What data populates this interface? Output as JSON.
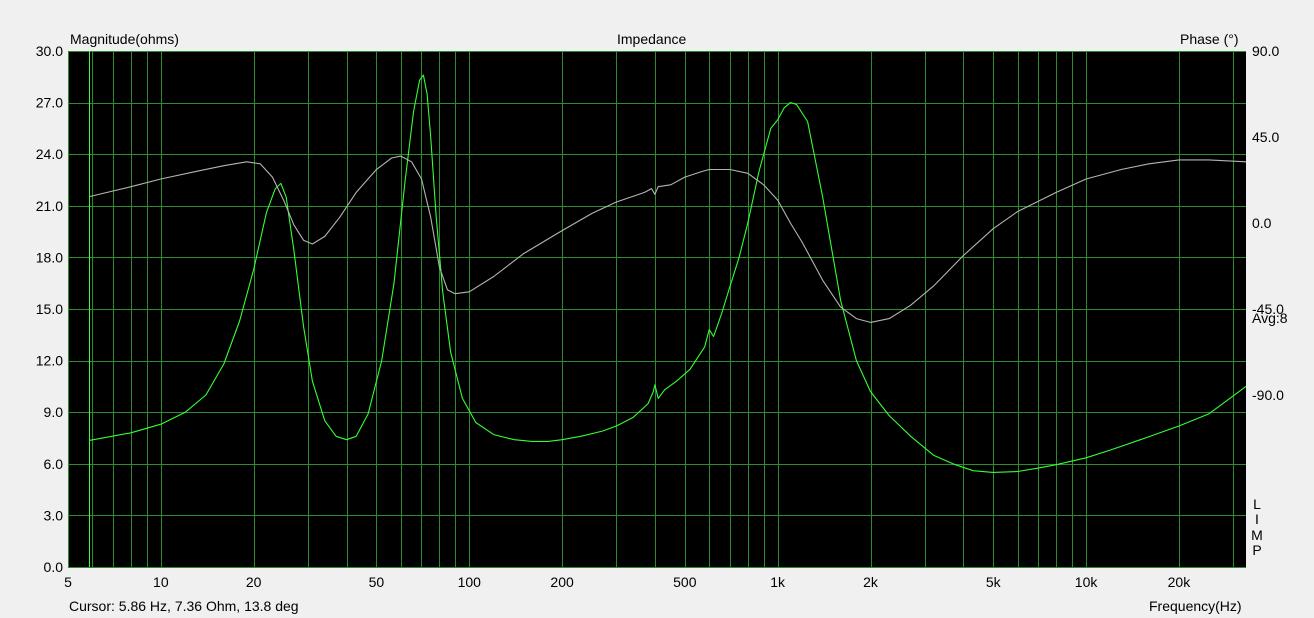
{
  "window": {
    "cursor_readout": "Cursor: 5.86 Hz, 7.36 Ohm, 13.8 deg",
    "avg_label": "Avg:8",
    "side_letters": [
      "L",
      "I",
      "M",
      "P"
    ]
  },
  "chart_data": {
    "type": "line",
    "title": "Impedance",
    "ylabel": "Magnitude(ohms)",
    "y2label": "Phase (°)",
    "xlabel": "Frequency(Hz)",
    "x_scale": "log",
    "xlim": [
      5,
      33000
    ],
    "ylim": [
      0,
      30
    ],
    "y2lim": [
      -180,
      90
    ],
    "x_ticks": [
      {
        "value": 5,
        "label": "5"
      },
      {
        "value": 10,
        "label": "10"
      },
      {
        "value": 20,
        "label": "20"
      },
      {
        "value": 50,
        "label": "50"
      },
      {
        "value": 100,
        "label": "100"
      },
      {
        "value": 200,
        "label": "200"
      },
      {
        "value": 500,
        "label": "500"
      },
      {
        "value": 1000,
        "label": "1k"
      },
      {
        "value": 2000,
        "label": "2k"
      },
      {
        "value": 5000,
        "label": "5k"
      },
      {
        "value": 10000,
        "label": "10k"
      },
      {
        "value": 20000,
        "label": "20k"
      }
    ],
    "y_ticks": [
      "0.0",
      "3.0",
      "6.0",
      "9.0",
      "12.0",
      "15.0",
      "18.0",
      "21.0",
      "24.0",
      "27.0",
      "30.0"
    ],
    "y2_ticks": [
      {
        "value": 90,
        "label": "90.0"
      },
      {
        "value": 45,
        "label": "45.0"
      },
      {
        "value": 0,
        "label": "0.0"
      },
      {
        "value": -45,
        "label": "-45.0"
      },
      {
        "value": -90,
        "label": "-90.0"
      }
    ],
    "grid": true,
    "colors": {
      "plot_bg": "#000000",
      "grid": "#2e8b2e",
      "magnitude": "#33ff33",
      "phase": "#b4b4b4",
      "window_bg": "#f0f0f0"
    },
    "series": [
      {
        "key": "magnitude",
        "axis": "left",
        "x": [
          5.86,
          8,
          10,
          12,
          14,
          16,
          18,
          20,
          22,
          23.5,
          24.5,
          25.5,
          27,
          29,
          31,
          34,
          37,
          40,
          43,
          47,
          52,
          57,
          62,
          66,
          69,
          71,
          73,
          75,
          78,
          82,
          87,
          95,
          105,
          120,
          140,
          160,
          180,
          200,
          230,
          270,
          300,
          340,
          380,
          395,
          400,
          410,
          430,
          470,
          520,
          580,
          600,
          620,
          660,
          700,
          720,
          750,
          800,
          870,
          950,
          1000,
          1050,
          1100,
          1150,
          1250,
          1400,
          1600,
          1800,
          2000,
          2300,
          2700,
          3200,
          3700,
          4300,
          5000,
          6000,
          7000,
          8000,
          10000,
          12000,
          15000,
          20000,
          25000,
          33000
        ],
        "y": [
          7.36,
          7.8,
          8.3,
          9.0,
          10.0,
          11.8,
          14.3,
          17.3,
          20.6,
          22.0,
          22.3,
          21.5,
          18.4,
          14.0,
          10.8,
          8.5,
          7.6,
          7.4,
          7.6,
          8.9,
          12.0,
          16.5,
          22.5,
          26.5,
          28.3,
          28.6,
          27.5,
          25.0,
          20.5,
          16.0,
          12.5,
          9.8,
          8.4,
          7.7,
          7.4,
          7.3,
          7.3,
          7.4,
          7.6,
          7.9,
          8.2,
          8.7,
          9.5,
          10.2,
          10.6,
          9.8,
          10.3,
          10.8,
          11.5,
          12.8,
          13.8,
          13.4,
          14.8,
          16.3,
          17.0,
          18.0,
          20.0,
          23.0,
          25.5,
          26.0,
          26.7,
          27.0,
          26.9,
          25.9,
          21.5,
          15.5,
          12.0,
          10.2,
          8.8,
          7.6,
          6.5,
          6.0,
          5.6,
          5.5,
          5.55,
          5.75,
          5.95,
          6.35,
          6.8,
          7.4,
          8.2,
          8.9,
          10.5
        ]
      },
      {
        "key": "phase",
        "axis": "right",
        "x": [
          5.86,
          8,
          10,
          13,
          16,
          19,
          21,
          23,
          25,
          27,
          29,
          31,
          34,
          38,
          43,
          50,
          56,
          60,
          65,
          70,
          75,
          80,
          85,
          90,
          100,
          120,
          150,
          200,
          250,
          300,
          370,
          390,
          400,
          410,
          450,
          500,
          570,
          600,
          620,
          700,
          800,
          900,
          1000,
          1100,
          1200,
          1400,
          1600,
          1800,
          2000,
          2300,
          2700,
          3200,
          4000,
          5000,
          6000,
          8000,
          10000,
          13000,
          16000,
          20000,
          25000,
          33000
        ],
        "y": [
          13.8,
          19,
          23,
          27,
          30,
          32,
          31,
          24,
          12,
          -1,
          -9,
          -11,
          -7,
          3,
          16,
          28,
          34,
          35,
          32,
          23,
          3,
          -23,
          -35,
          -37,
          -36,
          -28,
          -16,
          -4,
          5,
          11,
          16,
          18,
          15,
          19,
          20,
          24,
          27,
          28,
          28,
          28,
          26,
          20,
          12,
          0,
          -10,
          -30,
          -44,
          -50,
          -52,
          -50,
          -43,
          -33,
          -17,
          -3,
          6,
          16,
          23,
          28,
          31,
          33,
          33,
          32
        ]
      }
    ]
  }
}
